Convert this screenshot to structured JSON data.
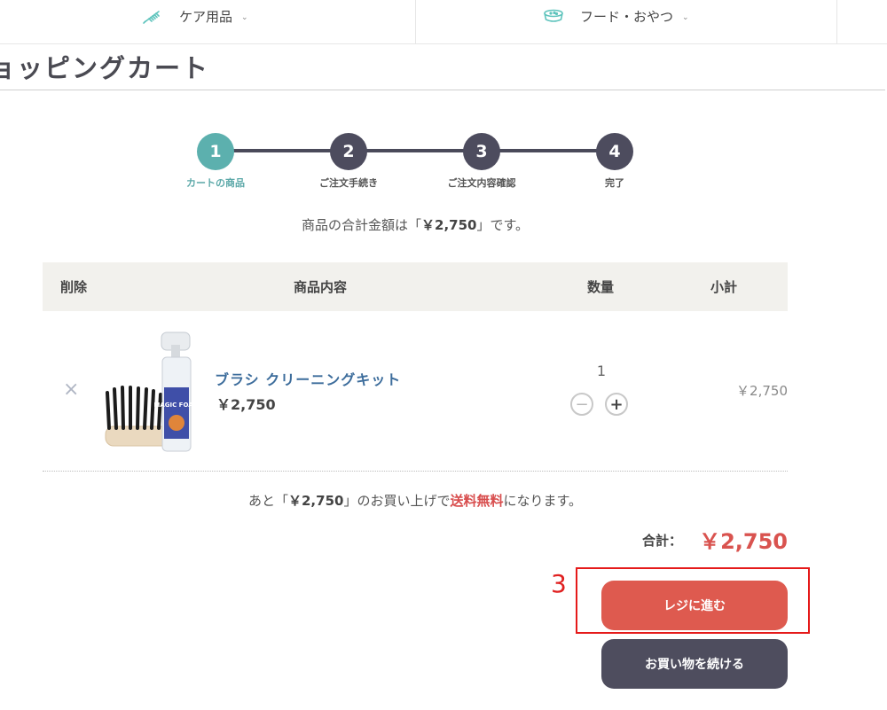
{
  "nav": {
    "items": [
      {
        "label": "ケア用品",
        "icon": "brush-icon"
      },
      {
        "label": "フード・おやつ",
        "icon": "food-bowl-icon"
      }
    ],
    "chevron": "⌄"
  },
  "page": {
    "title": "ョッピングカート"
  },
  "steps": [
    {
      "number": "1",
      "label": "カートの商品",
      "active": true
    },
    {
      "number": "2",
      "label": "ご注文手続き",
      "active": false
    },
    {
      "number": "3",
      "label": "ご注文内容確認",
      "active": false
    },
    {
      "number": "4",
      "label": "完了",
      "active": false
    }
  ],
  "summary": {
    "prefix": "商品の合計金額は「",
    "amount": "￥2,750",
    "suffix": "」です。"
  },
  "table": {
    "headers": {
      "remove": "削除",
      "product": "商品内容",
      "quantity": "数量",
      "subtotal": "小計"
    },
    "rows": [
      {
        "remove": "×",
        "name": "ブラシ クリーニングキット",
        "price": "￥2,750",
        "quantity": "1",
        "minus": "−",
        "plus": "+",
        "subtotal": "￥2,750",
        "image_text": "MAGIC FOAM"
      }
    ]
  },
  "shipping": {
    "prefix": "あと「",
    "amount": "￥2,750",
    "middle": "」のお買い上げで",
    "highlight": "送料無料",
    "suffix": "になります。"
  },
  "total": {
    "label": "合計：",
    "value": "￥2,750"
  },
  "annotation": {
    "label": "3"
  },
  "buttons": {
    "checkout": "レジに進む",
    "continue": "お買い物を続ける"
  },
  "colors": {
    "accent_teal": "#5cb0ae",
    "step_dark": "#4d4c5e",
    "price_red": "#d9534f",
    "checkout_button": "#de5a4f",
    "continue_button": "#4e4d5e",
    "annotation_red": "#e51a1a",
    "link_blue": "#3d6d9c"
  }
}
